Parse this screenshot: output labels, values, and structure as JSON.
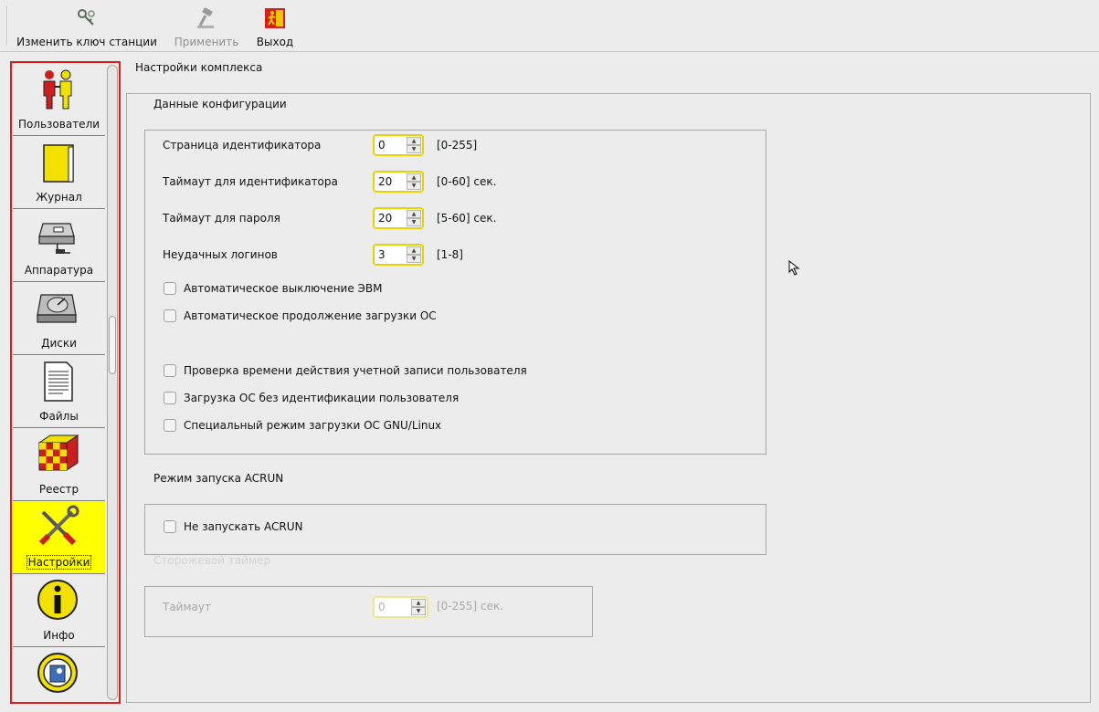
{
  "toolbar": {
    "change_key_label": "Изменить ключ станции",
    "apply_label": "Применить",
    "exit_label": "Выход"
  },
  "sidebar": {
    "items": [
      {
        "label": "Пользователи",
        "icon": "users-icon"
      },
      {
        "label": "Журнал",
        "icon": "journal-book-icon"
      },
      {
        "label": "Аппаратура",
        "icon": "hardware-scanner-icon"
      },
      {
        "label": "Диски",
        "icon": "disk-drive-icon"
      },
      {
        "label": "Файлы",
        "icon": "document-file-icon"
      },
      {
        "label": "Реестр",
        "icon": "registry-cube-icon"
      },
      {
        "label": "Настройки",
        "icon": "settings-tools-icon",
        "active": true
      },
      {
        "label": "Инфо",
        "icon": "info-icon"
      },
      {
        "label": "",
        "icon": "user-update-icon"
      }
    ]
  },
  "main": {
    "title": "Настройки комплекса",
    "config": {
      "title": "Данные конфигурации",
      "fields": [
        {
          "label": "Страница идентификатора",
          "value": "0",
          "range": "[0-255]"
        },
        {
          "label": "Таймаут для идентификатора",
          "value": "20",
          "range": "[0-60] сек."
        },
        {
          "label": "Таймаут для пароля",
          "value": "20",
          "range": "[5-60] сек."
        },
        {
          "label": "Неудачных логинов",
          "value": "3",
          "range": "[1-8]"
        }
      ],
      "checkboxes": [
        {
          "label": "Автоматическое выключение ЭВМ",
          "checked": false
        },
        {
          "label": "Автоматическое продолжение загрузки ОС",
          "checked": false
        },
        {
          "label": "Проверка времени действия учетной записи пользователя",
          "checked": false
        },
        {
          "label": "Загрузка ОС без идентификации пользователя",
          "checked": false
        },
        {
          "label": "Специальный режим загрузки ОС GNU/Linux",
          "checked": false
        }
      ]
    },
    "acrun": {
      "title": "Режим запуска ACRUN",
      "checkbox_label": "Не запускать ACRUN",
      "checked": false
    },
    "watchdog": {
      "title": "Сторожевой таймер",
      "timeout_label": "Таймаут",
      "timeout_value": "0",
      "timeout_range": "[0-255] сек."
    }
  },
  "colors": {
    "sidebar_border": "#e01a1a",
    "active_item": "#ffff00",
    "spin_border": "#e5d200",
    "background": "#ececec"
  }
}
